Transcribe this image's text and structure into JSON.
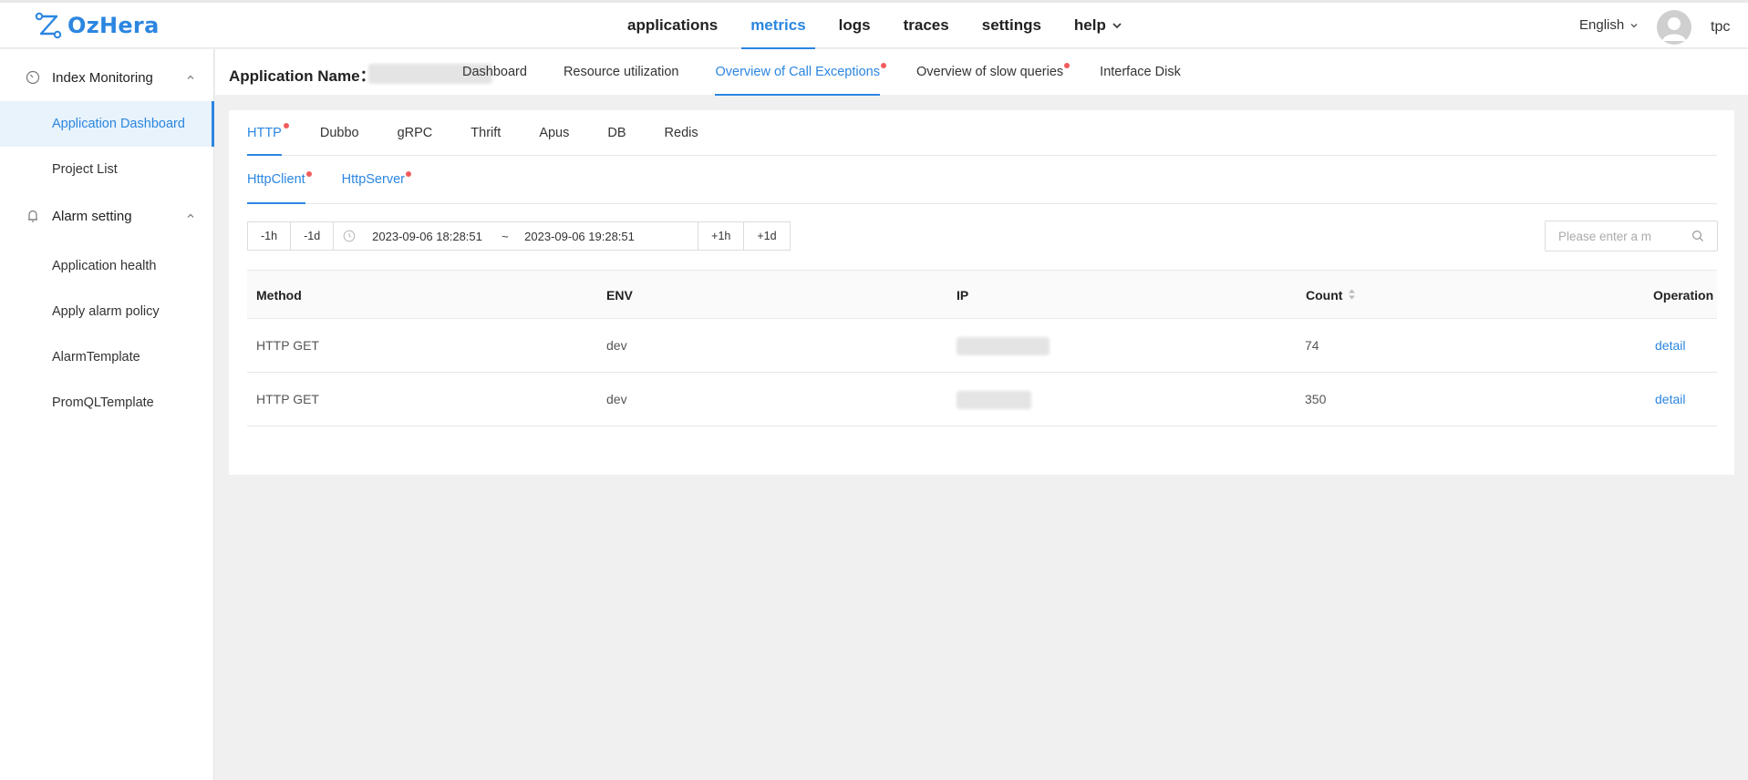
{
  "brand": {
    "name": "OzHera"
  },
  "header": {
    "nav": [
      {
        "label": "applications",
        "active": false
      },
      {
        "label": "metrics",
        "active": true
      },
      {
        "label": "logs",
        "active": false
      },
      {
        "label": "traces",
        "active": false
      },
      {
        "label": "settings",
        "active": false
      },
      {
        "label": "help",
        "active": false,
        "has_dropdown": true
      }
    ],
    "language": "English",
    "user": "tpc"
  },
  "sidebar": {
    "groups": [
      {
        "label": "Index Monitoring",
        "icon": "gauge-icon",
        "expanded": true,
        "items": [
          {
            "label": "Application Dashboard",
            "active": true
          },
          {
            "label": "Project List",
            "active": false
          }
        ]
      },
      {
        "label": "Alarm setting",
        "icon": "bell-icon",
        "expanded": true,
        "items": [
          {
            "label": "Application health",
            "active": false
          },
          {
            "label": "Apply alarm policy",
            "active": false
          },
          {
            "label": "AlarmTemplate",
            "active": false
          },
          {
            "label": "PromQLTemplate",
            "active": false
          }
        ]
      }
    ]
  },
  "subheader": {
    "app_label": "Application Name：",
    "tabs": [
      {
        "label": "Dashboard",
        "active": false,
        "dot": false
      },
      {
        "label": "Resource utilization",
        "active": false,
        "dot": false
      },
      {
        "label": "Overview of Call Exceptions",
        "active": true,
        "dot": true
      },
      {
        "label": "Overview of slow queries",
        "active": false,
        "dot": true
      },
      {
        "label": "Interface Disk",
        "active": false,
        "dot": false
      }
    ]
  },
  "protocol_tabs": [
    {
      "label": "HTTP",
      "active": true,
      "dot": true
    },
    {
      "label": "Dubbo",
      "active": false,
      "dot": false
    },
    {
      "label": "gRPC",
      "active": false,
      "dot": false
    },
    {
      "label": "Thrift",
      "active": false,
      "dot": false
    },
    {
      "label": "Apus",
      "active": false,
      "dot": false
    },
    {
      "label": "DB",
      "active": false,
      "dot": false
    },
    {
      "label": "Redis",
      "active": false,
      "dot": false
    }
  ],
  "side_tabs": [
    {
      "label": "HttpClient",
      "active": true,
      "dot": true
    },
    {
      "label": "HttpServer",
      "active": false,
      "dot": true
    }
  ],
  "time_filter": {
    "minus_hour": "-1h",
    "minus_day": "-1d",
    "from": "2023-09-06 18:28:51",
    "separator": "~",
    "to": "2023-09-06 19:28:51",
    "plus_hour": "+1h",
    "plus_day": "+1d"
  },
  "search": {
    "placeholder": "Please enter a m",
    "value": ""
  },
  "table": {
    "columns": [
      "Method",
      "ENV",
      "IP",
      "Count",
      "Operation"
    ],
    "rows": [
      {
        "method": "HTTP GET",
        "env": "dev",
        "count": "74",
        "operation": "detail"
      },
      {
        "method": "HTTP GET",
        "env": "dev",
        "count": "350",
        "operation": "detail"
      }
    ]
  },
  "colors": {
    "accent": "#2b86e0",
    "badge": "#f25c5c",
    "active_bg": "#e8f3fc"
  }
}
